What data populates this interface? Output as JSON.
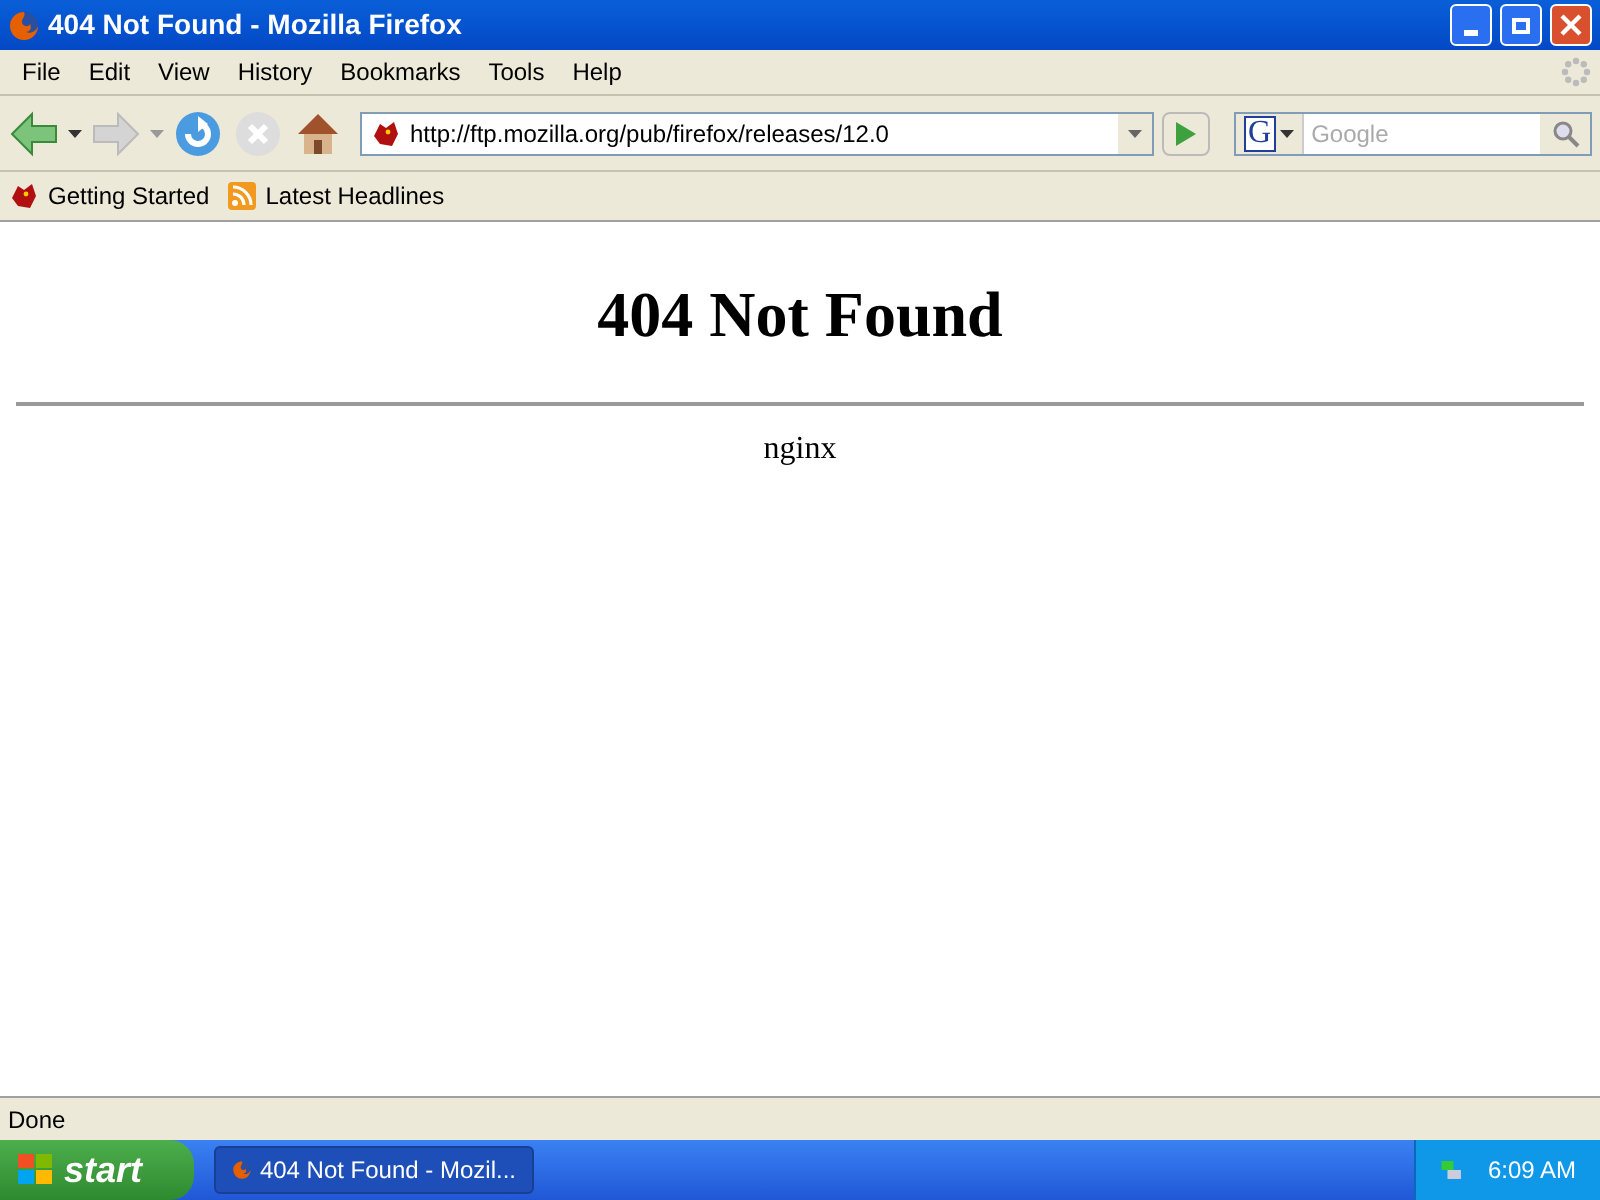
{
  "window": {
    "title": "404 Not Found - Mozilla Firefox"
  },
  "menu": [
    "File",
    "Edit",
    "View",
    "History",
    "Bookmarks",
    "Tools",
    "Help"
  ],
  "address": {
    "value": "http://ftp.mozilla.org/pub/firefox/releases/12.0"
  },
  "search": {
    "engine": "G",
    "placeholder": "Google"
  },
  "bookmarks": [
    {
      "label": "Getting Started",
      "kind": "page"
    },
    {
      "label": "Latest Headlines",
      "kind": "feed"
    }
  ],
  "page": {
    "heading": "404 Not Found",
    "footer": "nginx"
  },
  "status_bar": "Done",
  "taskbar": {
    "start": "start",
    "tasks": [
      {
        "label": "404 Not Found - Mozil...",
        "selected": true
      }
    ],
    "clock": "6:09 AM"
  }
}
